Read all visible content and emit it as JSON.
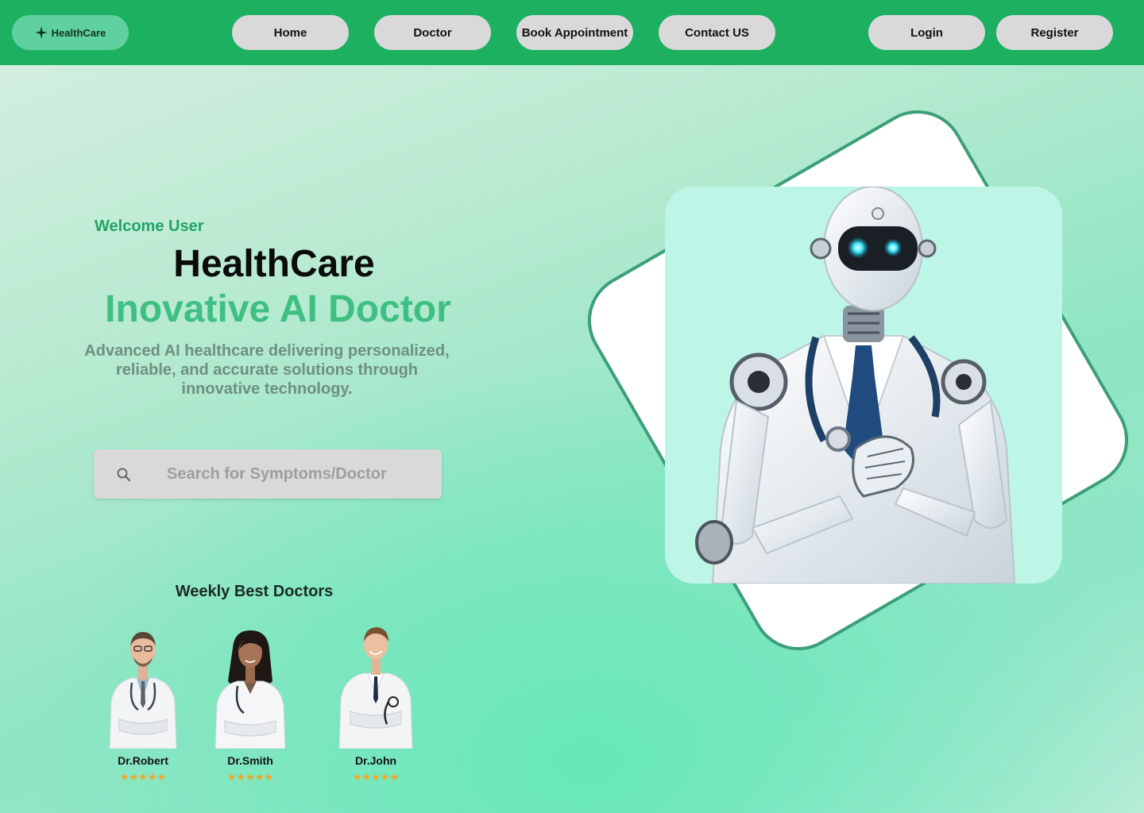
{
  "nav": {
    "logo_text": "HealthCare",
    "logo_icon": "sparkle-icon",
    "items": [
      {
        "label": "Home"
      },
      {
        "label": "Doctor"
      },
      {
        "label": "Book Appointment"
      },
      {
        "label": "Contact US"
      }
    ],
    "login_label": "Login",
    "register_label": "Register"
  },
  "hero": {
    "welcome": "Welcome User",
    "title": "HealthCare",
    "subtitle": "Inovative AI Doctor",
    "description": "Advanced AI healthcare delivering personalized, reliable, and accurate solutions through innovative technology.",
    "search_placeholder": "Search for Symptoms/Doctor"
  },
  "doctors": {
    "heading": "Weekly Best Doctors",
    "list": [
      {
        "name": "Dr.Robert",
        "rating": "★★★★★",
        "stars": 5
      },
      {
        "name": "Dr.Smith",
        "rating": "★★★★★",
        "stars": 5
      },
      {
        "name": "Dr.John",
        "rating": "★★★★★",
        "stars": 5
      }
    ]
  },
  "colors": {
    "nav_bg": "#1db061",
    "accent_green": "#3fbf82",
    "star": "#f5a524",
    "frame": "#3c9f7a"
  }
}
